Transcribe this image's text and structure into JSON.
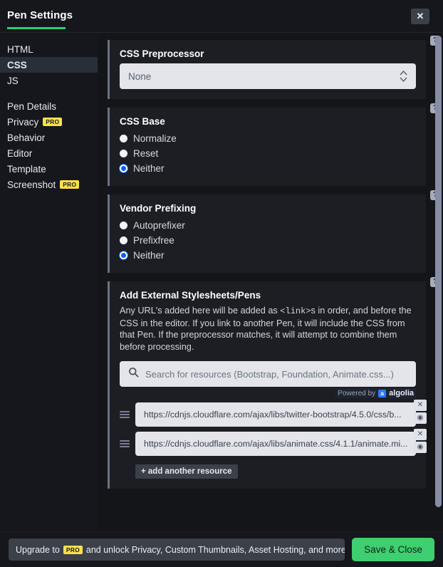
{
  "header": {
    "title": "Pen Settings",
    "close_label": "✕",
    "accent_color": "#2ecc71"
  },
  "sidebar": {
    "groups": [
      {
        "items": [
          {
            "label": "HTML",
            "active": false,
            "pro": false
          },
          {
            "label": "CSS",
            "active": true,
            "pro": false
          },
          {
            "label": "JS",
            "active": false,
            "pro": false
          }
        ]
      },
      {
        "items": [
          {
            "label": "Pen Details",
            "active": false,
            "pro": false
          },
          {
            "label": "Privacy",
            "active": false,
            "pro": true
          },
          {
            "label": "Behavior",
            "active": false,
            "pro": false
          },
          {
            "label": "Editor",
            "active": false,
            "pro": false
          },
          {
            "label": "Template",
            "active": false,
            "pro": false
          },
          {
            "label": "Screenshot",
            "active": false,
            "pro": true
          }
        ]
      }
    ],
    "pro_badge": "PRO"
  },
  "main": {
    "help_glyph": "?",
    "preprocessor": {
      "title": "CSS Preprocessor",
      "value": "None"
    },
    "css_base": {
      "title": "CSS Base",
      "options": [
        {
          "label": "Normalize",
          "checked": false
        },
        {
          "label": "Reset",
          "checked": false
        },
        {
          "label": "Neither",
          "checked": true
        }
      ]
    },
    "vendor_prefixing": {
      "title": "Vendor Prefixing",
      "options": [
        {
          "label": "Autoprefixer",
          "checked": false
        },
        {
          "label": "Prefixfree",
          "checked": false
        },
        {
          "label": "Neither",
          "checked": true
        }
      ]
    },
    "external": {
      "title": "Add External Stylesheets/Pens",
      "description_1": "Any URL's added here will be added as ",
      "description_code": "<link>",
      "description_2": "s in order, and before the CSS in the editor. If you link to another Pen, it will include the CSS from that Pen. If the preprocessor matches, it will attempt to combine them before processing.",
      "search_placeholder": "Search for resources (Bootstrap, Foundation, Animate.css...)",
      "search_value": "",
      "powered_by": "Powered by",
      "algolia_mark": "a",
      "algolia_name": "algolia",
      "resources": [
        {
          "url": "https://cdnjs.cloudflare.com/ajax/libs/twitter-bootstrap/4.5.0/css/b...",
          "remove_label": "✕",
          "view_label": "◉"
        },
        {
          "url": "https://cdnjs.cloudflare.com/ajax/libs/animate.css/4.1.1/animate.mi...",
          "remove_label": "✕",
          "view_label": "◉"
        }
      ],
      "add_label": "+ add another resource"
    }
  },
  "footer": {
    "upgrade_prefix": "Upgrade to",
    "pro_badge": "PRO",
    "upgrade_suffix": "and unlock Privacy, Custom Thumbnails, Asset Hosting, and more.",
    "save_label": "Save & Close",
    "save_color": "#3ecf70"
  }
}
